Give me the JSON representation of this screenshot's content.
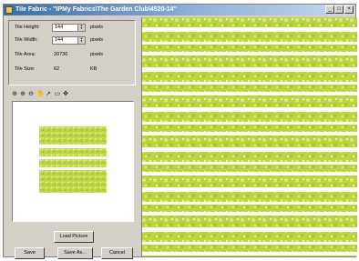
{
  "window": {
    "title": "Tile Fabric - \"IPMy Fabrics\\The Garden Club\\4520-14\"",
    "controls": [
      "_",
      "□",
      "×"
    ]
  },
  "tile_properties": {
    "height_label": "Tile Height:",
    "height_value": "144",
    "height_unit": "pixels",
    "width_label": "Tile Width:",
    "width_value": "144",
    "width_unit": "pixels",
    "area_label": "Tile Area:",
    "area_value": "20736",
    "area_unit": "pixels",
    "size_label": "Tile Size:",
    "size_value": "62",
    "size_unit": "KB"
  },
  "toolbar": {
    "icons": [
      "zoom-icon",
      "zoom-in-icon",
      "zoom-out-icon",
      "pan-icon",
      "select-icon",
      "rectangle-icon",
      "move-icon"
    ]
  },
  "buttons": {
    "load_picture": "Load Picture",
    "save": "Save",
    "save_as": "Save As...",
    "cancel": "Cancel"
  },
  "colors": {
    "window_bg": "#d4d0c8",
    "title_start": "#3a6ea5",
    "fabric_green": "#b9d43c",
    "fabric_light": "#e6f09a",
    "fabric_stripe": "#ffffff"
  }
}
